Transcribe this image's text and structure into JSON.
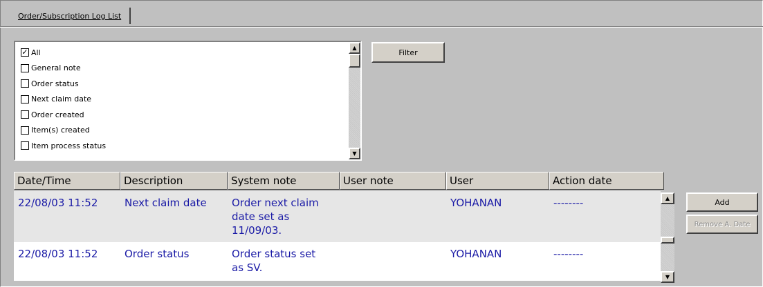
{
  "tab": {
    "label": "Order/Subscription Log List"
  },
  "filter_list": {
    "items": [
      {
        "label": "All",
        "checked": true
      },
      {
        "label": "General note",
        "checked": false
      },
      {
        "label": "Order status",
        "checked": false
      },
      {
        "label": "Next claim date",
        "checked": false
      },
      {
        "label": "Order created",
        "checked": false
      },
      {
        "label": "Item(s) created",
        "checked": false
      },
      {
        "label": "Item process status",
        "checked": false
      }
    ]
  },
  "buttons": {
    "filter": "Filter",
    "add": "Add",
    "remove_action_date": "Remove A. Date"
  },
  "grid": {
    "columns": [
      "Date/Time",
      "Description",
      "System note",
      "User note",
      "User",
      "Action date"
    ],
    "rows": [
      {
        "date_time": "22/08/03 11:52",
        "description": "Next claim date",
        "system_note": "Order next claim date set as 11/09/03.",
        "user_note": "",
        "user": "YOHANAN",
        "action_date": "--------"
      },
      {
        "date_time": "22/08/03 11:52",
        "description": "Order status",
        "system_note": "Order status set as SV.",
        "user_note": "",
        "user": "YOHANAN",
        "action_date": "--------"
      }
    ]
  },
  "colors": {
    "row_text": "#1a1aa6",
    "selected_row_bg": "#e6e6e6",
    "panel_bg": "#c0c0c0"
  }
}
